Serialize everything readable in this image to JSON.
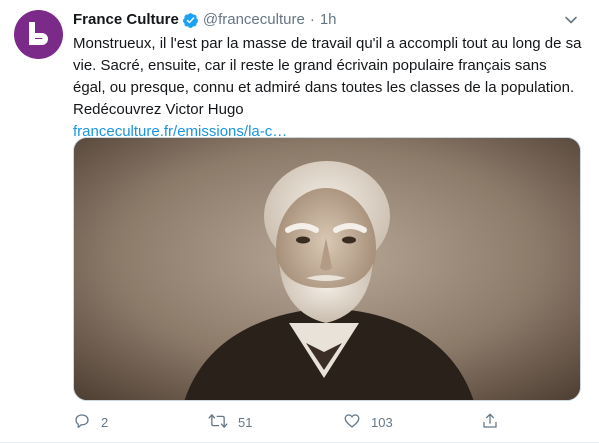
{
  "tweet": {
    "author_name": "France Culture",
    "handle": "@franceculture",
    "separator": "·",
    "time": "1h",
    "text": "Monstrueux, il l'est par la masse de travail qu'il a accompli tout au long de sa vie. Sacré, ensuite, car il reste le grand écrivain populaire français sans égal, ou presque, connu et admiré dans toutes les classes de la population. Redécouvrez Victor Hugo",
    "link": "franceculture.fr/emissions/la-c…",
    "verified": true
  },
  "actions": {
    "reply_count": "2",
    "retweet_count": "51",
    "like_count": "103"
  },
  "icons": {
    "avatar": "france-culture-logo",
    "verified": "verified-badge-icon",
    "caret": "chevron-down-icon",
    "reply": "reply-icon",
    "retweet": "retweet-icon",
    "like": "heart-icon",
    "share": "share-icon"
  },
  "colors": {
    "brand_avatar": "#7b2a8a",
    "link": "#1b95e0",
    "muted": "#657786",
    "verified": "#1da1f2"
  }
}
